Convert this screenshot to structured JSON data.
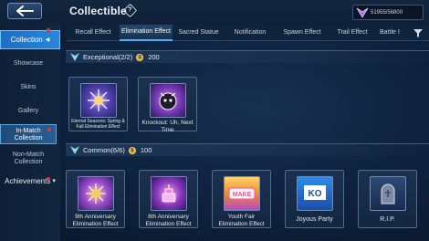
{
  "header": {
    "title": "Collectible",
    "help_symbol": "?",
    "currency": "51955/56800"
  },
  "tabs": [
    {
      "label": "Recall Effect",
      "active": false
    },
    {
      "label": "Elimination Effect",
      "active": true
    },
    {
      "label": "Sacred Statue",
      "active": false
    },
    {
      "label": "Notification",
      "active": false
    },
    {
      "label": "Spawn Effect",
      "active": false
    },
    {
      "label": "Trail Effect",
      "active": false
    },
    {
      "label": "Battle I",
      "active": false
    }
  ],
  "sidebar": {
    "top": {
      "label": "Collection",
      "symbol": "◀"
    },
    "items": [
      {
        "label": "Showcase"
      },
      {
        "label": "Skins"
      },
      {
        "label": "Gallery"
      },
      {
        "label": "In-Match Collection"
      },
      {
        "label": "Non-Match Collection"
      },
      {
        "label": "Achievements",
        "symbol": "▾"
      }
    ]
  },
  "sections": {
    "exceptional": {
      "title": "Exceptional(2/2)",
      "points": "200",
      "cards": [
        {
          "label": "Eternal Seasons: Spring & Fall Elimination Effect"
        },
        {
          "label": "Knockout: Uh, Next Time"
        }
      ]
    },
    "common": {
      "title": "Common(6/6)",
      "points": "100",
      "cards": [
        {
          "label": "9th Anniversary Elimination Effect"
        },
        {
          "label": "8th Anniversary Elimination Effect"
        },
        {
          "label": "Youth Fair Elimination Effect"
        },
        {
          "label": "Joyous Party"
        },
        {
          "label": "R.I.P."
        }
      ]
    }
  },
  "art": {
    "youth_fair_text": "MAKE",
    "joyous_party_text": "KO"
  },
  "colors": {
    "accent": "#2a86d8",
    "tab_active_underline": "#4fb0ff",
    "notification_dot": "#e5343a",
    "coin": "#d4a437"
  }
}
